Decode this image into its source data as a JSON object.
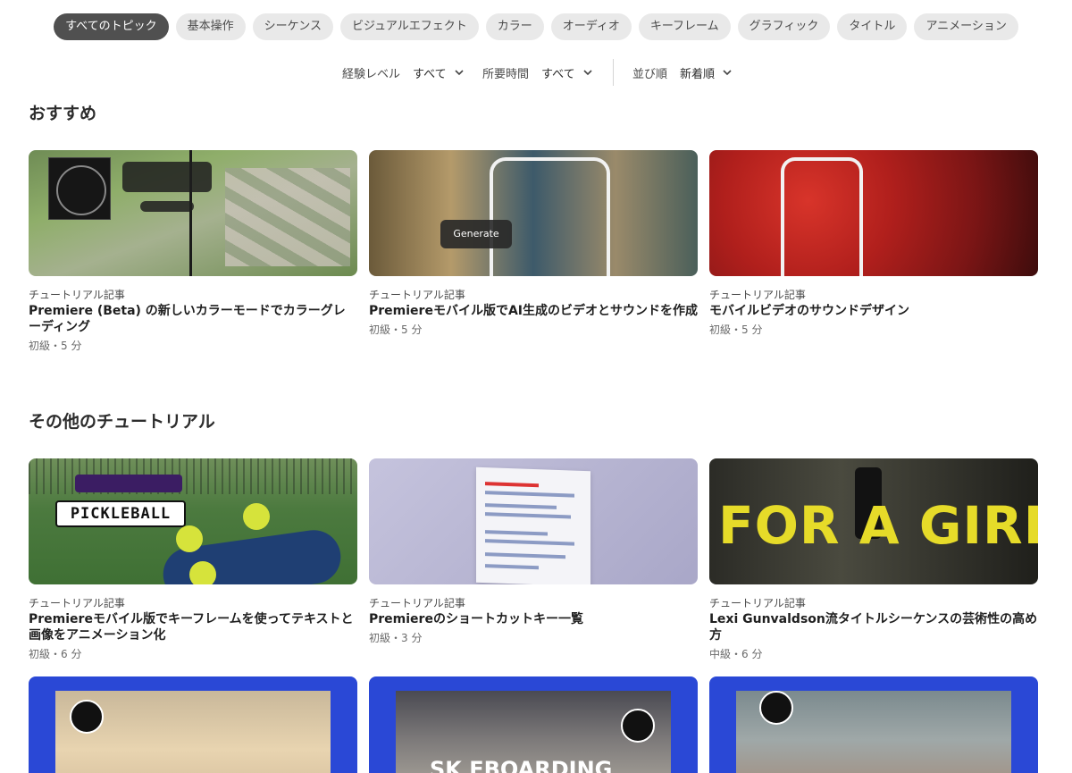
{
  "topics": [
    {
      "label": "すべてのトピック",
      "active": true
    },
    {
      "label": "基本操作",
      "active": false
    },
    {
      "label": "シーケンス",
      "active": false
    },
    {
      "label": "ビジュアルエフェクト",
      "active": false
    },
    {
      "label": "カラー",
      "active": false
    },
    {
      "label": "オーディオ",
      "active": false
    },
    {
      "label": "キーフレーム",
      "active": false
    },
    {
      "label": "グラフィック",
      "active": false
    },
    {
      "label": "タイトル",
      "active": false
    },
    {
      "label": "アニメーション",
      "active": false
    }
  ],
  "filters": {
    "level": {
      "label": "経験レベル",
      "value": "すべて"
    },
    "duration": {
      "label": "所要時間",
      "value": "すべて"
    },
    "sort": {
      "label": "並び順",
      "value": "新着順"
    }
  },
  "recommended": {
    "title": "おすすめ",
    "cards": [
      {
        "category": "チュートリアル記事",
        "title": "Premiere (Beta) の新しいカラーモードでカラーグレーディング",
        "meta": "初級・5 分"
      },
      {
        "category": "チュートリアル記事",
        "title": "Premiereモバイル版でAI生成のビデオとサウンドを作成",
        "meta": "初級・5 分",
        "button": "Generate"
      },
      {
        "category": "チュートリアル記事",
        "title": "モバイルビデオのサウンドデザイン",
        "meta": "初級・5 分"
      }
    ]
  },
  "others": {
    "title": "その他のチュートリアル",
    "cards": [
      {
        "category": "チュートリアル記事",
        "title": "Premiereモバイル版でキーフレームを使ってテキストと画像をアニメーション化",
        "meta": "初級・6 分",
        "overlay": "PICKLEBALL"
      },
      {
        "category": "チュートリアル記事",
        "title": "Premiereのショートカットキー一覧",
        "meta": "初級・3 分"
      },
      {
        "category": "チュートリアル記事",
        "title": "Lexi Gunvaldson流タイトルシーケンスの芸術性の高め方",
        "meta": "中級・6 分",
        "overlay": "FOR A GIRL"
      }
    ],
    "partial": [
      {
        "overlay": ""
      },
      {
        "overlay": "SK EBOARDING"
      },
      {
        "overlay": ""
      }
    ]
  }
}
